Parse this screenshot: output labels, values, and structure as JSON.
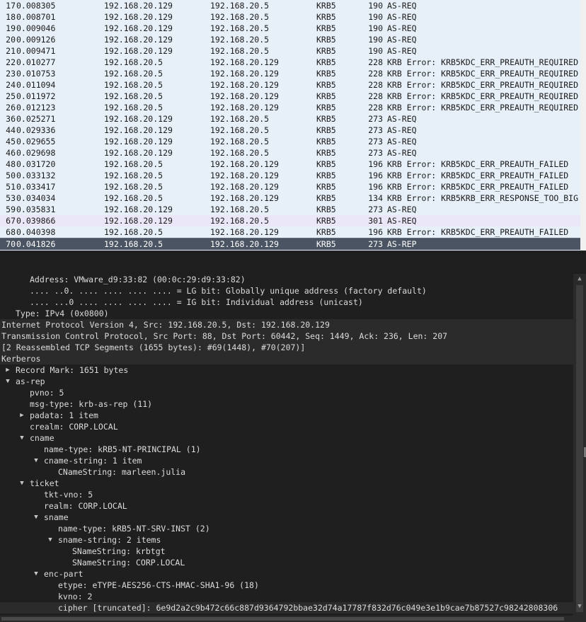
{
  "packets": [
    {
      "no": "17",
      "time": "0.008305",
      "src": "192.168.20.129",
      "dst": "192.168.20.5",
      "proto": "KRB5",
      "len": "190",
      "info": "AS-REQ"
    },
    {
      "no": "18",
      "time": "0.008701",
      "src": "192.168.20.129",
      "dst": "192.168.20.5",
      "proto": "KRB5",
      "len": "190",
      "info": "AS-REQ"
    },
    {
      "no": "19",
      "time": "0.009046",
      "src": "192.168.20.129",
      "dst": "192.168.20.5",
      "proto": "KRB5",
      "len": "190",
      "info": "AS-REQ"
    },
    {
      "no": "20",
      "time": "0.009126",
      "src": "192.168.20.129",
      "dst": "192.168.20.5",
      "proto": "KRB5",
      "len": "190",
      "info": "AS-REQ"
    },
    {
      "no": "21",
      "time": "0.009471",
      "src": "192.168.20.129",
      "dst": "192.168.20.5",
      "proto": "KRB5",
      "len": "190",
      "info": "AS-REQ"
    },
    {
      "no": "22",
      "time": "0.010277",
      "src": "192.168.20.5",
      "dst": "192.168.20.129",
      "proto": "KRB5",
      "len": "228",
      "info": "KRB Error: KRB5KDC_ERR_PREAUTH_REQUIRED"
    },
    {
      "no": "23",
      "time": "0.010753",
      "src": "192.168.20.5",
      "dst": "192.168.20.129",
      "proto": "KRB5",
      "len": "228",
      "info": "KRB Error: KRB5KDC_ERR_PREAUTH_REQUIRED"
    },
    {
      "no": "24",
      "time": "0.011094",
      "src": "192.168.20.5",
      "dst": "192.168.20.129",
      "proto": "KRB5",
      "len": "228",
      "info": "KRB Error: KRB5KDC_ERR_PREAUTH_REQUIRED"
    },
    {
      "no": "25",
      "time": "0.011972",
      "src": "192.168.20.5",
      "dst": "192.168.20.129",
      "proto": "KRB5",
      "len": "228",
      "info": "KRB Error: KRB5KDC_ERR_PREAUTH_REQUIRED"
    },
    {
      "no": "26",
      "time": "0.012123",
      "src": "192.168.20.5",
      "dst": "192.168.20.129",
      "proto": "KRB5",
      "len": "228",
      "info": "KRB Error: KRB5KDC_ERR_PREAUTH_REQUIRED"
    },
    {
      "no": "36",
      "time": "0.025271",
      "src": "192.168.20.129",
      "dst": "192.168.20.5",
      "proto": "KRB5",
      "len": "273",
      "info": "AS-REQ"
    },
    {
      "no": "44",
      "time": "0.029336",
      "src": "192.168.20.129",
      "dst": "192.168.20.5",
      "proto": "KRB5",
      "len": "273",
      "info": "AS-REQ"
    },
    {
      "no": "45",
      "time": "0.029655",
      "src": "192.168.20.129",
      "dst": "192.168.20.5",
      "proto": "KRB5",
      "len": "273",
      "info": "AS-REQ"
    },
    {
      "no": "46",
      "time": "0.029698",
      "src": "192.168.20.129",
      "dst": "192.168.20.5",
      "proto": "KRB5",
      "len": "273",
      "info": "AS-REQ"
    },
    {
      "no": "48",
      "time": "0.031720",
      "src": "192.168.20.5",
      "dst": "192.168.20.129",
      "proto": "KRB5",
      "len": "196",
      "info": "KRB Error: KRB5KDC_ERR_PREAUTH_FAILED"
    },
    {
      "no": "50",
      "time": "0.033132",
      "src": "192.168.20.5",
      "dst": "192.168.20.129",
      "proto": "KRB5",
      "len": "196",
      "info": "KRB Error: KRB5KDC_ERR_PREAUTH_FAILED"
    },
    {
      "no": "51",
      "time": "0.033417",
      "src": "192.168.20.5",
      "dst": "192.168.20.129",
      "proto": "KRB5",
      "len": "196",
      "info": "KRB Error: KRB5KDC_ERR_PREAUTH_FAILED"
    },
    {
      "no": "53",
      "time": "0.034034",
      "src": "192.168.20.5",
      "dst": "192.168.20.129",
      "proto": "KRB5",
      "len": "134",
      "info": "KRB Error: KRB5KRB_ERR_RESPONSE_TOO_BIG"
    },
    {
      "no": "59",
      "time": "0.035831",
      "src": "192.168.20.129",
      "dst": "192.168.20.5",
      "proto": "KRB5",
      "len": "273",
      "info": "AS-REQ"
    },
    {
      "no": "67",
      "time": "0.039866",
      "src": "192.168.20.129",
      "dst": "192.168.20.5",
      "proto": "KRB5",
      "len": "301",
      "info": "AS-REQ"
    },
    {
      "no": "68",
      "time": "0.040398",
      "src": "192.168.20.5",
      "dst": "192.168.20.129",
      "proto": "KRB5",
      "len": "196",
      "info": "KRB Error: KRB5KDC_ERR_PREAUTH_FAILED"
    },
    {
      "no": "70",
      "time": "0.041826",
      "src": "192.168.20.5",
      "dst": "192.168.20.129",
      "proto": "KRB5",
      "len": "273",
      "info": "AS-REP"
    }
  ],
  "details": [
    {
      "text": "Address: VMware_d9:33:82 (00:0c:29:d9:33:82)"
    },
    {
      "text": ".... ..0. .... .... .... .... = LG bit: Globally unique address (factory default)"
    },
    {
      "text": ".... ...0 .... .... .... .... = IG bit: Individual address (unicast)"
    },
    {
      "text": "Type: IPv4 (0x0800)"
    },
    {
      "text": "Internet Protocol Version 4, Src: 192.168.20.5, Dst: 192.168.20.129"
    },
    {
      "text": "Transmission Control Protocol, Src Port: 88, Dst Port: 60442, Seq: 1449, Ack: 236, Len: 207"
    },
    {
      "text": "[2 Reassembled TCP Segments (1655 bytes): #69(1448), #70(207)]"
    },
    {
      "text": "Kerberos"
    },
    {
      "text": "Record Mark: 1651 bytes"
    },
    {
      "text": "as-rep"
    },
    {
      "text": "pvno: 5"
    },
    {
      "text": "msg-type: krb-as-rep (11)"
    },
    {
      "text": "padata: 1 item"
    },
    {
      "text": "crealm: CORP.LOCAL"
    },
    {
      "text": "cname"
    },
    {
      "text": "name-type: kRB5-NT-PRINCIPAL (1)"
    },
    {
      "text": "cname-string: 1 item"
    },
    {
      "text": "CNameString: marleen.julia"
    },
    {
      "text": "ticket"
    },
    {
      "text": "tkt-vno: 5"
    },
    {
      "text": "realm: CORP.LOCAL"
    },
    {
      "text": "sname"
    },
    {
      "text": "name-type: kRB5-NT-SRV-INST (2)"
    },
    {
      "text": "sname-string: 2 items"
    },
    {
      "text": "SNameString: krbtgt"
    },
    {
      "text": "SNameString: CORP.LOCAL"
    },
    {
      "text": "enc-part"
    },
    {
      "text": "etype: eTYPE-AES256-CTS-HMAC-SHA1-96 (18)"
    },
    {
      "text": "kvno: 2"
    },
    {
      "text": "cipher [truncated]: 6e9d2a2c9b472c66c887d9364792bbae32d74a17787f832d76c049e3e1b9cae7b87527c98242808306"
    }
  ],
  "icons": {
    "collapsed": "collapsed-arrow-icon",
    "expanded": "expanded-arrow-icon",
    "scroll_up": "scroll-up-icon",
    "scroll_down": "scroll-down-icon"
  },
  "colors": {
    "list_background": "#e7f0f9",
    "highlight_row": "#ece7f8",
    "selected_row": "#4b5462",
    "detail_background": "#1f1f1f"
  }
}
